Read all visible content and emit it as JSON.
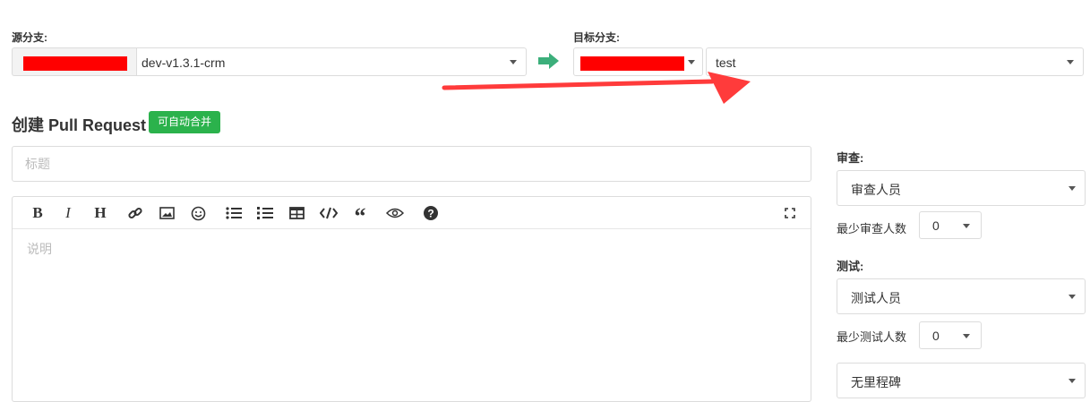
{
  "source": {
    "label": "源分支:",
    "branch": "dev-v1.3.1-crm"
  },
  "target": {
    "label": "目标分支:",
    "branch": "test"
  },
  "pr": {
    "heading": "创建 Pull Request",
    "badge": "可自动合并"
  },
  "form": {
    "title_placeholder": "标题",
    "desc_placeholder": "说明"
  },
  "sidebar": {
    "review_label": "审查:",
    "reviewer_select": "审查人员",
    "min_reviewer_label": "最少审查人数",
    "min_reviewer_value": "0",
    "test_label": "测试:",
    "tester_select": "测试人员",
    "min_tester_label": "最少测试人数",
    "min_tester_value": "0",
    "milestone_select": "无里程碑"
  },
  "toolbar": {
    "icons": [
      "bold-icon",
      "italic-icon",
      "heading-icon",
      "link-icon",
      "image-icon",
      "emoji-icon",
      "bullet-list-icon",
      "numbered-list-icon",
      "table-icon",
      "code-icon",
      "quote-icon",
      "preview-icon",
      "help-icon",
      "fullscreen-icon"
    ]
  },
  "colors": {
    "accent_green": "#2bb24c",
    "arrow_green": "#3caf7b",
    "annotation_red": "#ff3b3b",
    "redaction": "#ff0000"
  }
}
